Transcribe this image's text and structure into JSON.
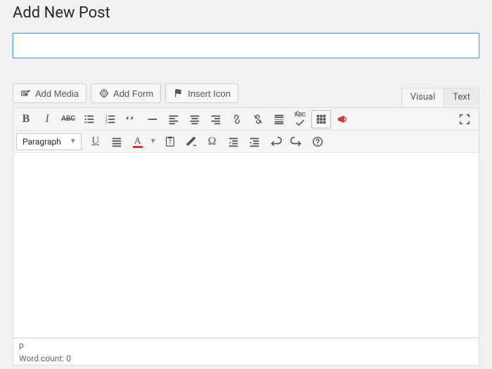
{
  "page": {
    "heading": "Add New Post",
    "title_value": "",
    "title_placeholder": ""
  },
  "media_buttons": {
    "add_media": "Add Media",
    "add_form": "Add Form",
    "insert_icon": "Insert Icon"
  },
  "tabs": {
    "visual": "Visual",
    "text": "Text",
    "active": "visual"
  },
  "format": {
    "label": "Paragraph"
  },
  "status": {
    "path": "p",
    "word_count_label": "Word count:",
    "word_count": 0
  },
  "icons": {
    "media": "camera-music",
    "form": "target",
    "flag": "flag",
    "bold": "B",
    "italic": "I",
    "strike": "ABC",
    "ul": "bulleted-list",
    "ol": "numbered-list",
    "quote": "blockquote",
    "hr": "horizontal-rule",
    "align_left": "align-left",
    "align_center": "align-center",
    "align_right": "align-right",
    "link": "link",
    "unlink": "unlink",
    "more": "read-more",
    "spell": "spellcheck",
    "kitchen": "toolbar-toggle",
    "mega": "megaphone",
    "fullscreen": "fullscreen",
    "underline": "U",
    "justify": "align-justify",
    "color": "A",
    "paste": "paste-text",
    "clear": "clear-format",
    "omega": "special-char",
    "outdent": "outdent",
    "indent": "indent",
    "undo": "undo",
    "redo": "redo",
    "help": "help"
  }
}
